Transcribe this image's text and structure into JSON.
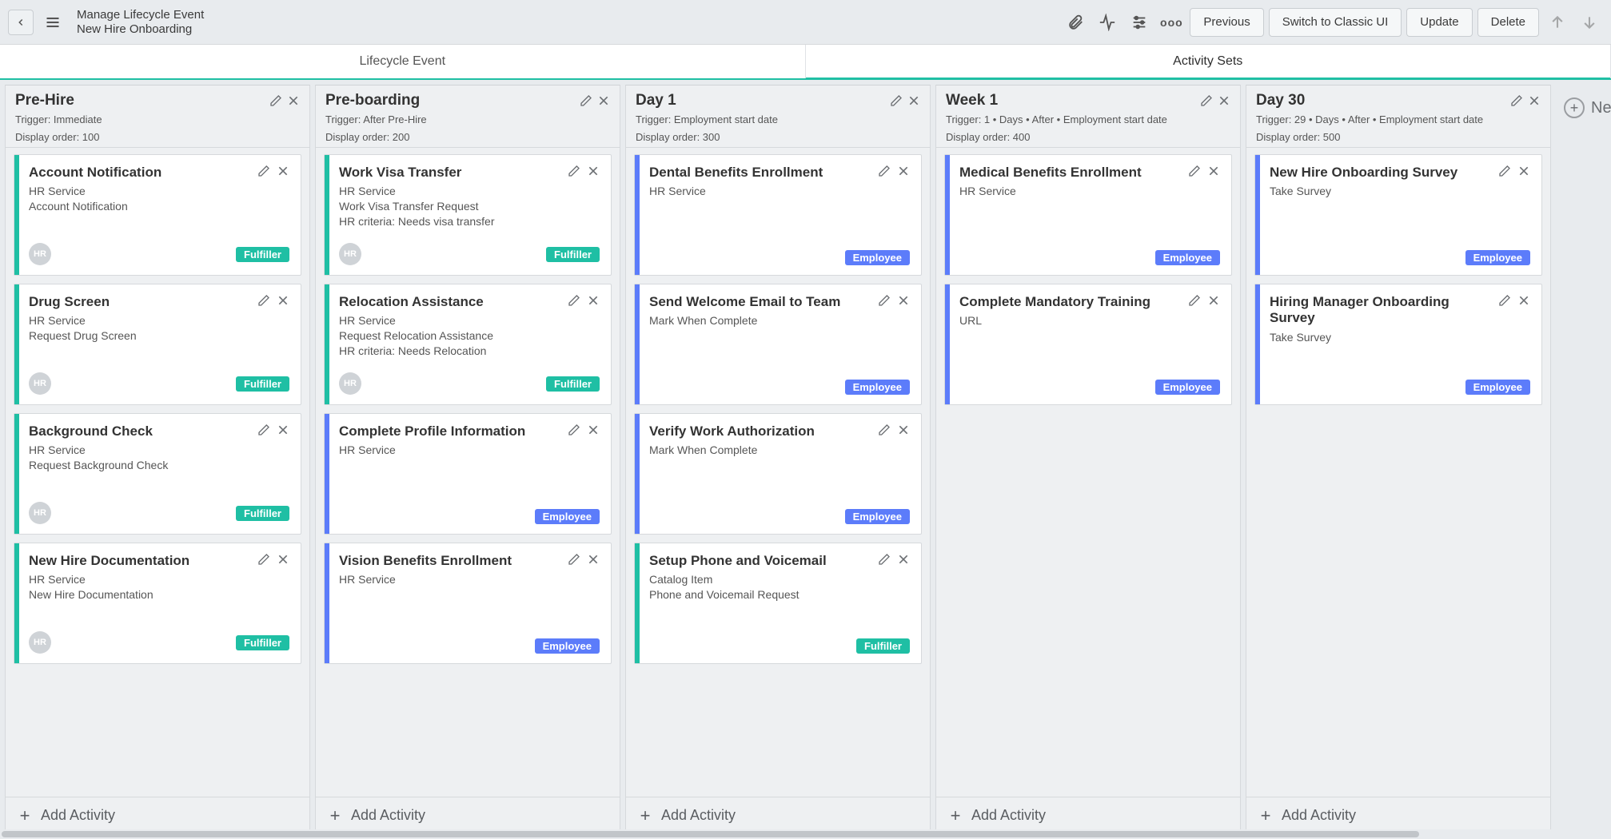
{
  "header": {
    "title_line1": "Manage Lifecycle Event",
    "title_line2": "New Hire Onboarding",
    "buttons": {
      "previous": "Previous",
      "switch_classic": "Switch to Classic UI",
      "update": "Update",
      "delete": "Delete"
    },
    "more_label": "ooo"
  },
  "tabs": [
    {
      "id": "lifecycle_event",
      "label": "Lifecycle Event",
      "active": false
    },
    {
      "id": "activity_sets",
      "label": "Activity Sets",
      "active": true
    }
  ],
  "new_column_label": "New A",
  "add_activity_label": "Add Activity",
  "columns": [
    {
      "title": "Pre-Hire",
      "trigger": "Trigger: Immediate",
      "display_order": "Display order: 100",
      "cards": [
        {
          "title": "Account Notification",
          "lines": [
            "HR Service",
            "Account Notification"
          ],
          "stripe": "teal",
          "avatar": "HR",
          "badge": "Fulfiller",
          "badge_type": "fulfiller"
        },
        {
          "title": "Drug Screen",
          "lines": [
            "HR Service",
            "Request Drug Screen"
          ],
          "stripe": "teal",
          "avatar": "HR",
          "badge": "Fulfiller",
          "badge_type": "fulfiller"
        },
        {
          "title": "Background Check",
          "lines": [
            "HR Service",
            "Request Background Check"
          ],
          "stripe": "teal",
          "avatar": "HR",
          "badge": "Fulfiller",
          "badge_type": "fulfiller"
        },
        {
          "title": "New Hire Documentation",
          "lines": [
            "HR Service",
            "New Hire Documentation"
          ],
          "stripe": "teal",
          "avatar": "HR",
          "badge": "Fulfiller",
          "badge_type": "fulfiller"
        }
      ]
    },
    {
      "title": "Pre-boarding",
      "trigger": "Trigger: After Pre-Hire",
      "display_order": "Display order: 200",
      "cards": [
        {
          "title": "Work Visa Transfer",
          "lines": [
            "HR Service",
            "Work Visa Transfer Request",
            "HR criteria: Needs visa transfer"
          ],
          "stripe": "teal",
          "avatar": "HR",
          "badge": "Fulfiller",
          "badge_type": "fulfiller"
        },
        {
          "title": "Relocation Assistance",
          "lines": [
            "HR Service",
            "Request Relocation Assistance",
            "HR criteria: Needs Relocation"
          ],
          "stripe": "teal",
          "avatar": "HR",
          "badge": "Fulfiller",
          "badge_type": "fulfiller"
        },
        {
          "title": "Complete Profile Information",
          "lines": [
            "HR Service"
          ],
          "stripe": "blue",
          "avatar": "",
          "badge": "Employee",
          "badge_type": "employee"
        },
        {
          "title": "Vision Benefits Enrollment",
          "lines": [
            "HR Service"
          ],
          "stripe": "blue",
          "avatar": "",
          "badge": "Employee",
          "badge_type": "employee"
        }
      ]
    },
    {
      "title": "Day 1",
      "trigger": "Trigger: Employment start date",
      "display_order": "Display order: 300",
      "cards": [
        {
          "title": "Dental Benefits Enrollment",
          "lines": [
            "HR Service"
          ],
          "stripe": "blue",
          "avatar": "",
          "badge": "Employee",
          "badge_type": "employee"
        },
        {
          "title": "Send Welcome Email to Team",
          "lines": [
            "Mark When Complete"
          ],
          "stripe": "blue",
          "avatar": "",
          "badge": "Employee",
          "badge_type": "employee"
        },
        {
          "title": "Verify Work Authorization",
          "lines": [
            "Mark When Complete"
          ],
          "stripe": "blue",
          "avatar": "",
          "badge": "Employee",
          "badge_type": "employee"
        },
        {
          "title": "Setup Phone and Voicemail",
          "lines": [
            "Catalog Item",
            "Phone and Voicemail Request"
          ],
          "stripe": "teal",
          "avatar": "",
          "badge": "Fulfiller",
          "badge_type": "fulfiller"
        }
      ]
    },
    {
      "title": "Week 1",
      "trigger": "Trigger: 1 • Days • After • Employment start date",
      "display_order": "Display order: 400",
      "cards": [
        {
          "title": "Medical Benefits Enrollment",
          "lines": [
            "HR Service"
          ],
          "stripe": "blue",
          "avatar": "",
          "badge": "Employee",
          "badge_type": "employee"
        },
        {
          "title": "Complete Mandatory Training",
          "lines": [
            "URL"
          ],
          "stripe": "blue",
          "avatar": "",
          "badge": "Employee",
          "badge_type": "employee"
        }
      ]
    },
    {
      "title": "Day 30",
      "trigger": "Trigger: 29 • Days • After • Employment start date",
      "display_order": "Display order: 500",
      "cards": [
        {
          "title": "New Hire Onboarding Survey",
          "lines": [
            "Take Survey"
          ],
          "stripe": "blue",
          "avatar": "",
          "badge": "Employee",
          "badge_type": "employee"
        },
        {
          "title": "Hiring Manager Onboarding Survey",
          "lines": [
            "Take Survey"
          ],
          "stripe": "blue",
          "avatar": "",
          "badge": "Employee",
          "badge_type": "employee"
        }
      ]
    }
  ]
}
